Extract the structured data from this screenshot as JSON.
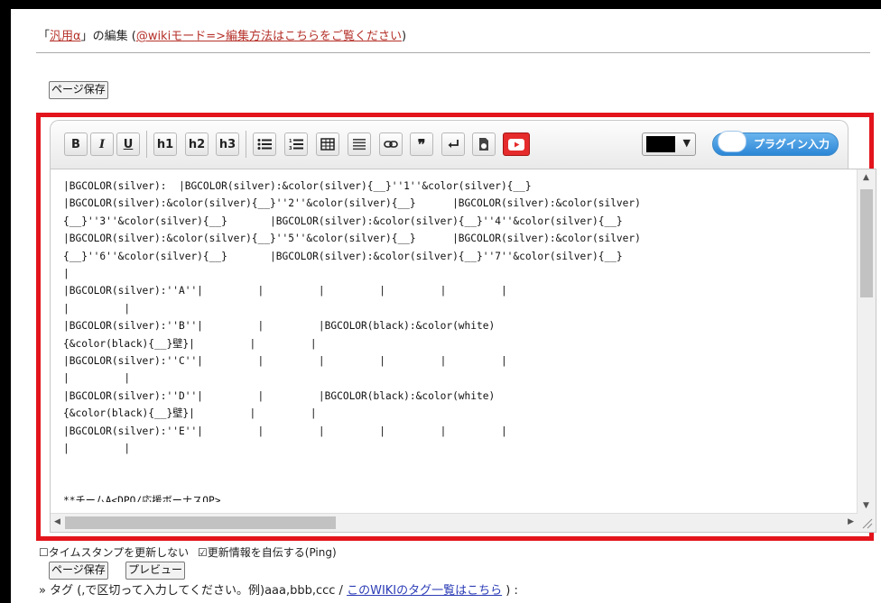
{
  "header": {
    "prefix": "「",
    "page_link": "汎用α",
    "middle": "」の編集 (",
    "help_link": "@wikiモード=>編集方法はこちらをご覧ください",
    "suffix": ")"
  },
  "save_button_top": "ページ保存",
  "toolbar": {
    "bold": "B",
    "italic": "I",
    "underline": "U",
    "h1": "h1",
    "h2": "h2",
    "h3": "h3",
    "color_value": "#000000",
    "plugin_label": "プラグイン入力"
  },
  "editor": {
    "content": "|BGCOLOR(silver):  |BGCOLOR(silver):&color(silver){__}''1''&color(silver){__}\n|BGCOLOR(silver):&color(silver){__}''2''&color(silver){__}      |BGCOLOR(silver):&color(silver)\n{__}''3''&color(silver){__}       |BGCOLOR(silver):&color(silver){__}''4''&color(silver){__}\n|BGCOLOR(silver):&color(silver){__}''5''&color(silver){__}      |BGCOLOR(silver):&color(silver)\n{__}''6''&color(silver){__}       |BGCOLOR(silver):&color(silver){__}''7''&color(silver){__}\n|\n|BGCOLOR(silver):''A''|         |         |         |         |         |\n|         |\n|BGCOLOR(silver):''B''|         |         |BGCOLOR(black):&color(white)\n{&color(black){__}壁}|         |         |\n|BGCOLOR(silver):''C''|         |         |         |         |         |\n|         |\n|BGCOLOR(silver):''D''|         |         |BGCOLOR(black):&color(white)\n{&color(black){__}壁}|         |         |\n|BGCOLOR(silver):''E''|         |         |         |         |         |\n|         |\n\n\n**チームA<DPO/応援ボーナスOP>\n|BGCOLOR(silver):  名前  |BGCOLOR(silver):  性別  |BGCOLOR(silver):  攻  |BGCOLOR(silver):"
  },
  "options": {
    "no_timestamp": "タイムスタンプを更新しない",
    "ping": "更新情報を自伝する(Ping)"
  },
  "buttons": {
    "save": "ページ保存",
    "preview": "プレビュー"
  },
  "tags": {
    "prefix": "» タグ (,で区切って入力してください。例)aaa,bbb,ccc /",
    "link": "このWIKIのタグ一覧はこちら",
    "suffix": ") :"
  }
}
